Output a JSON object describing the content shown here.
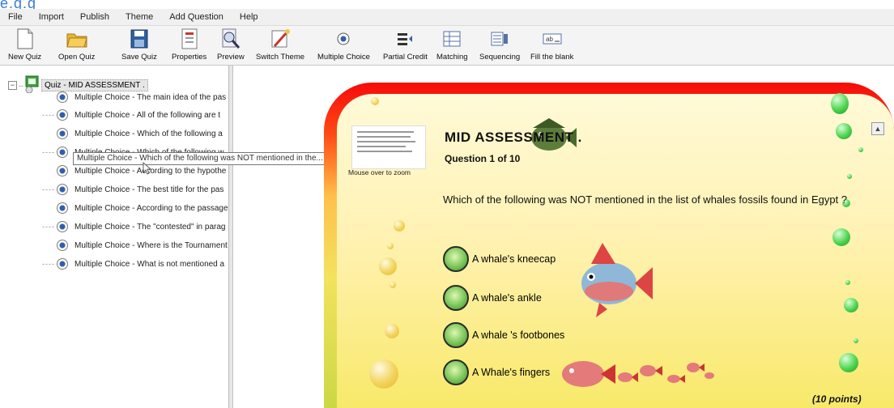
{
  "app": {
    "corner_title": "e.g.g"
  },
  "menu": [
    "File",
    "Import",
    "Publish",
    "Theme",
    "Add Question",
    "Help"
  ],
  "toolbar": {
    "new_quiz": "New Quiz",
    "open_quiz": "Open Quiz",
    "save_quiz": "Save Quiz",
    "properties": "Properties",
    "preview": "Preview",
    "switch_theme": "Switch Theme",
    "multiple_choice": "Multiple Choice",
    "partial_credit": "Partial Credit",
    "matching": "Matching",
    "sequencing": "Sequencing",
    "fill_blank": "Fill the blank"
  },
  "tree": {
    "root_label": "Quiz - MID ASSESSMENT .",
    "items": [
      "Multiple Choice - The main idea of the pas",
      "Multiple Choice - All of the following are t",
      "Multiple Choice - Which of the following a",
      "Multiple Choice - Which of the following w",
      "Multiple Choice - According to the hypothe",
      "Multiple Choice - The best title for the pas",
      "Multiple Choice - According to the passage",
      "Multiple Choice - The \"contested\" in parag",
      "Multiple Choice - Where is the Tournament",
      "Multiple Choice - What is not mentioned a"
    ],
    "tooltip": "Multiple Choice - Which of the following was NOT mentioned in the..."
  },
  "preview": {
    "thumb_caption": "Mouse over to zoom",
    "title": "MID ASSESSMENT .",
    "subtitle": "Question 1 of 10",
    "question": "Which of the following was NOT mentioned in the list of whales fossils found in Egypt ?",
    "answers": [
      "A whale's  kneecap",
      "A whale's ankle",
      "A whale 's footbones",
      "A Whale's fingers"
    ],
    "points": "(10 points)"
  },
  "colors": {
    "stage_border_top": "#f50a0a",
    "stage_fill": "#fff2b3",
    "answer_button": "#79c65a"
  }
}
